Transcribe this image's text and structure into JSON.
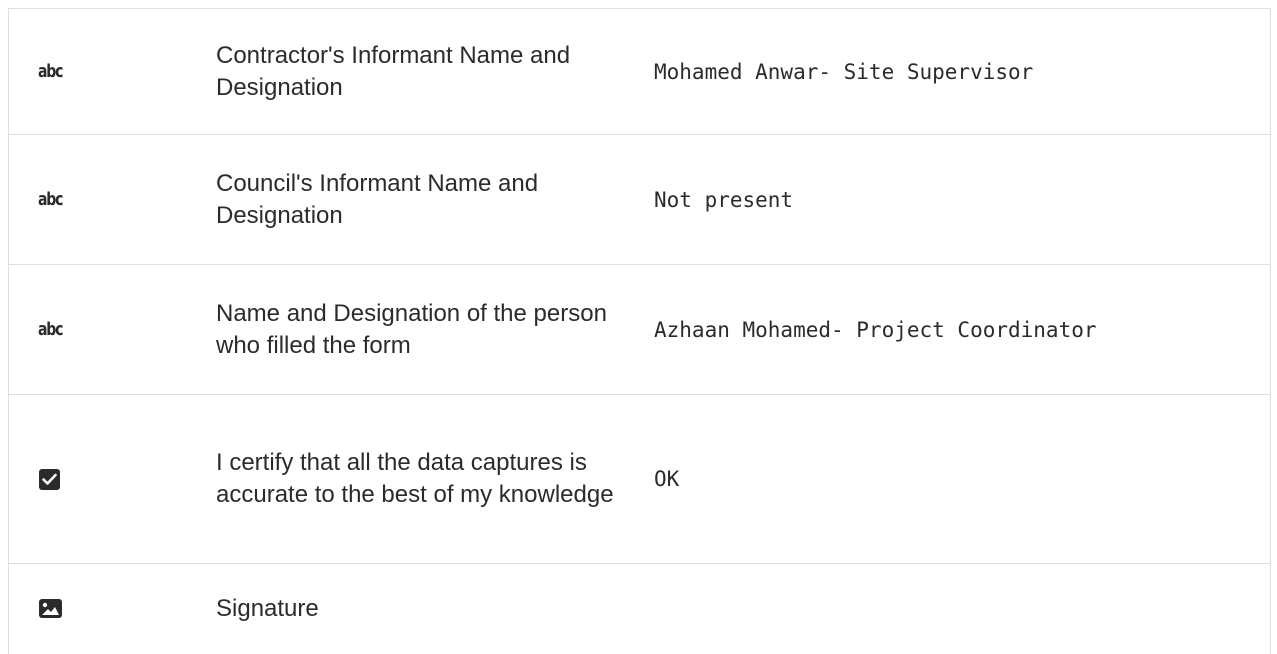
{
  "rows": [
    {
      "type_icon": "text-type-icon",
      "type_glyph": "abc",
      "label": "Contractor's Informant Name and Designation",
      "value": "Mohamed Anwar- Site Supervisor"
    },
    {
      "type_icon": "text-type-icon",
      "type_glyph": "abc",
      "label": "Council's Informant Name and Designation",
      "value": "Not present"
    },
    {
      "type_icon": "text-type-icon",
      "type_glyph": "abc",
      "label": "Name and Designation of the person who filled the form",
      "value": "Azhaan Mohamed- Project Coordinator"
    },
    {
      "type_icon": "checkbox-icon",
      "label": "I certify that all the data captures is accurate to the best of my knowledge",
      "value": "OK"
    },
    {
      "type_icon": "image-icon",
      "label": "Signature",
      "value": ""
    }
  ],
  "colors": {
    "text": "#2b2b2b",
    "border": "#dedede",
    "background": "#ffffff"
  }
}
